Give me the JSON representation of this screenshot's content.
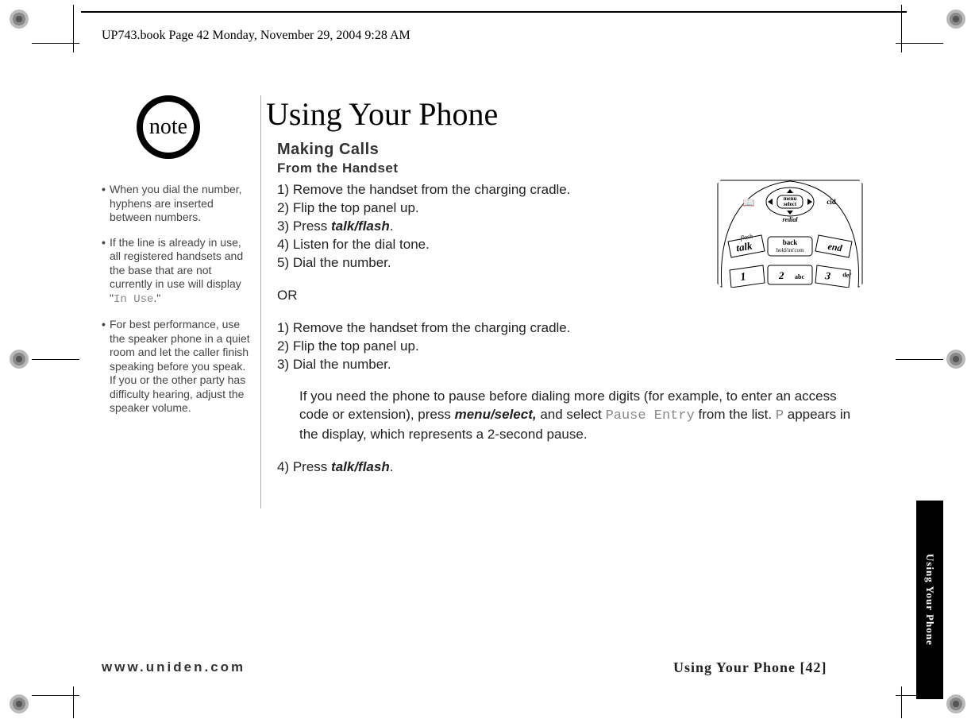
{
  "header": "UP743.book  Page 42  Monday, November 29, 2004  9:28 AM",
  "note_badge": "note",
  "notes": [
    {
      "pre": "When you dial the number, hyphens are inserted between numbers.",
      "lcd": "",
      "post": ""
    },
    {
      "pre": "If the line is already in use, all registered handsets and the base that are not currently in use will display \"",
      "lcd": "In Use",
      "post": ".\""
    },
    {
      "pre": "For best performance, use the speaker phone in a quiet room and let the caller finish speaking before you speak. If you or the other party has difficulty hearing, adjust the speaker volume.",
      "lcd": "",
      "post": ""
    }
  ],
  "title": "Using Your Phone",
  "section": "Making Calls",
  "subsection": "From the Handset",
  "steps_a": [
    "1) Remove the handset from the charging cradle.",
    "2) Flip the top panel up.",
    {
      "pre": "3) Press ",
      "bi": "talk/flash",
      "post": "."
    },
    "4) Listen for the dial tone.",
    "5) Dial the number."
  ],
  "or_label": "OR",
  "steps_b": [
    "1) Remove the handset from the charging cradle.",
    "2) Flip the top panel up.",
    "3) Dial the number."
  ],
  "pause_para": {
    "t1": "If you need the phone to pause before dialing more digits (for example, to enter an access code or extension), press ",
    "bi": "menu/select,",
    "t2": " and select ",
    "lcd1": "Pause Entry",
    "t3": " from the list. ",
    "lcd2": "P",
    "t4": " appears in the display, which represents a 2-second pause."
  },
  "step4": {
    "pre": "4) Press ",
    "bi": "talk/flash",
    "post": "."
  },
  "footer_left": "www.uniden.com",
  "footer_right": "Using Your Phone [42]",
  "tab_label": "Using Your Phone",
  "illus": {
    "menu": "menu",
    "select": "select",
    "redial": "redial",
    "flash": "flash",
    "talk": "talk",
    "back": "back",
    "hold": "hold/int'com",
    "end": "end",
    "cid": "cid",
    "k1": "1",
    "k2": "2",
    "k2s": "abc",
    "k3": "3",
    "k3s": "def"
  }
}
